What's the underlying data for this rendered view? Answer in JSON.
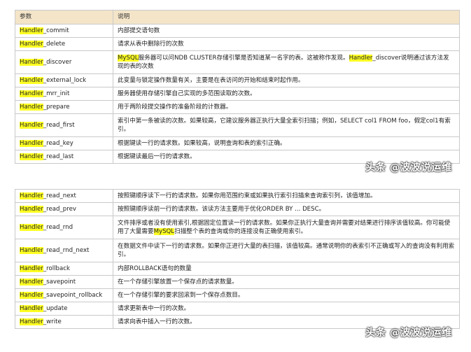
{
  "table1": {
    "headers": {
      "param": "参数",
      "desc": "说明"
    },
    "rows": [
      {
        "prefix": "Handler",
        "suffix": "_commit",
        "desc": "内部提交语句数"
      },
      {
        "prefix": "Handler",
        "suffix": "_delete",
        "desc": "请求从表中删除行的次数"
      },
      {
        "prefix": "Handler",
        "suffix": "_discover",
        "desc_html": "<span class=\"hl\">MySQL</span>服务器可以问NDB CLUSTER存储引擎是否知道某一名字的表。这被称作发现。<span class=\"hl\">Handler</span>_discover说明通过该方法发现的表的次数"
      },
      {
        "prefix": "Handler",
        "suffix": "_external_lock",
        "desc": "此变量与锁定操作数量有关，主要是在表访问的开始和结束时起作用。"
      },
      {
        "prefix": "Handler",
        "suffix": "_mrr_init",
        "desc": "服务器使用存储引擎自己实现的多范围读取的次数。"
      },
      {
        "prefix": "Handler",
        "suffix": "_prepare",
        "desc": "用于两阶段提交操作的准备阶段的计数器。"
      },
      {
        "prefix": "Handler",
        "suffix": "_read_first",
        "desc": "索引中第一条被读的次数。如果较高，它建议服务器正执行大量全索引扫描；例如，SELECT col1 FROM foo，假定col1有索引。"
      },
      {
        "prefix": "Handler",
        "suffix": "_read_key",
        "desc": "根据键读一行的请求数。如果较高，说明查询和表的索引正确。"
      },
      {
        "prefix": "Handler",
        "suffix": "_read_last",
        "desc": "根据键读最后一行的请求数。"
      }
    ]
  },
  "table2": {
    "rows": [
      {
        "prefix": "Handler",
        "suffix": "_read_next",
        "desc": "按照键顺序读下一行的请求数。如果你用范围约束或如果执行索引扫描来查询索引列，该值增加。"
      },
      {
        "prefix": "Handler",
        "suffix": "_read_prev",
        "desc": "按照键顺序读前一行的请求数。该读方法主要用于优化ORDER BY ... DESC。"
      },
      {
        "prefix": "Handler",
        "suffix": "_read_rnd",
        "desc_html": "文件排序或者没有使用索引,根据固定位置读一行的请求数。如果你正执行大量查询并需要对结果进行排序该值较高。你可能使用了大量需要<span class=\"hl\">MySQL</span>扫描整个表的查询或你的连接没有正确使用索引。"
      },
      {
        "prefix": "Handler",
        "suffix": "_read_rnd_next",
        "desc": "在数据文件中读下一行的请求数。如果你正进行大量的表扫描，该值较高。通常说明你的表索引不正确或写入的查询没有利用索引。"
      },
      {
        "prefix": "Handler",
        "suffix": "_rollback",
        "desc": "内部ROLLBACK语句的数量"
      },
      {
        "prefix": "Handler",
        "suffix": "_savepoint",
        "desc": "在一个存储引擎放置一个保存点的请求数量。"
      },
      {
        "prefix": "Handler",
        "suffix": "_savepoint_rollback",
        "desc": "在一个存储引擎的要求回滚到一个保存点数目。"
      },
      {
        "prefix": "Handler",
        "suffix": "_update",
        "desc": "请求更新表中一行的次数。"
      },
      {
        "prefix": "Handler",
        "suffix": "_write",
        "desc": "请求向表中插入一行的次数。"
      }
    ]
  },
  "watermark": "头条 @波波说运维",
  "colors": {
    "highlight": "#ffff22",
    "header_bg": "#f4e5c9",
    "border": "#c9c9c9"
  }
}
